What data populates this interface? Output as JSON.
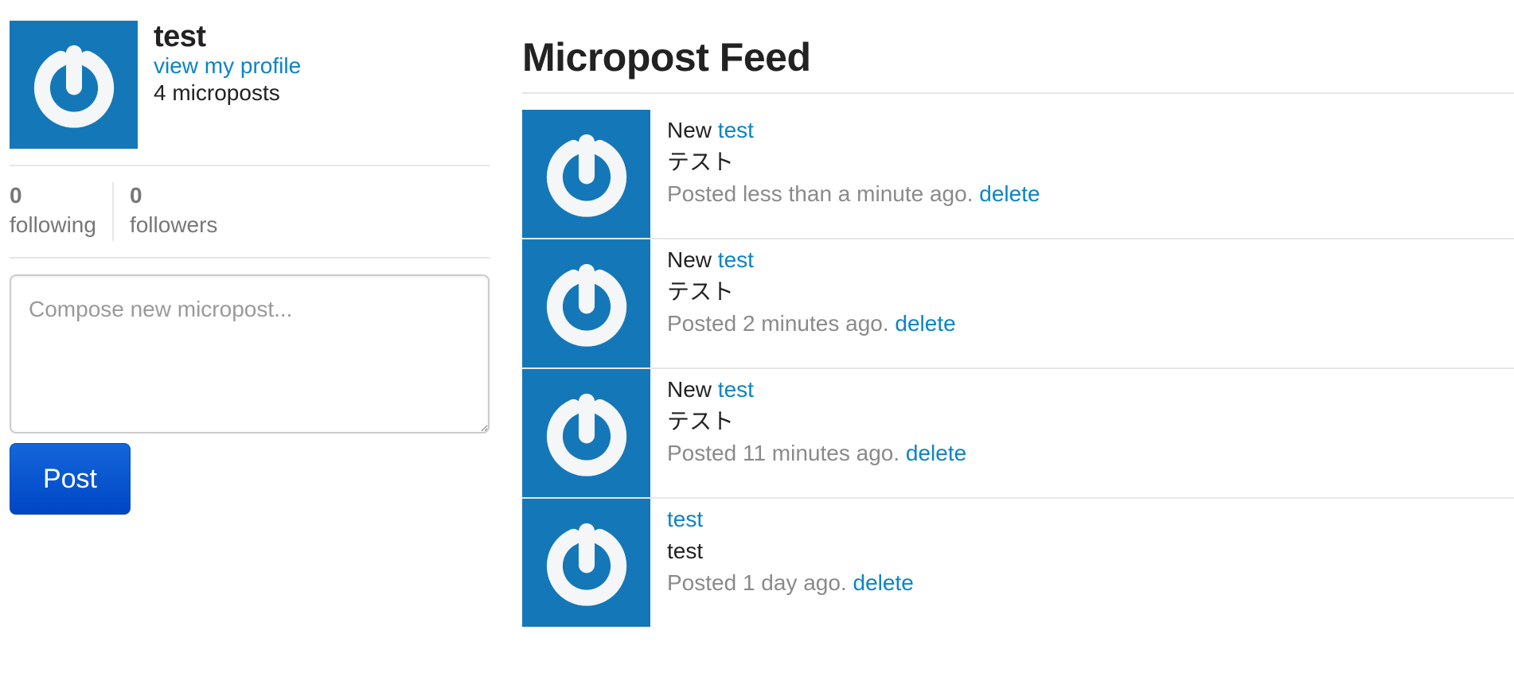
{
  "sidebar": {
    "user_name": "test",
    "profile_link": "view my profile",
    "micropost_count": "4 microposts",
    "stats": {
      "following_count": "0",
      "following_label": "following",
      "followers_count": "0",
      "followers_label": "followers"
    },
    "compose_placeholder": "Compose new micropost...",
    "post_button": "Post"
  },
  "feed": {
    "title": "Micropost Feed",
    "items": [
      {
        "prefix": "New",
        "user": "test",
        "content": "テスト",
        "timestamp": "Posted less than a minute ago.",
        "delete": "delete"
      },
      {
        "prefix": "New",
        "user": "test",
        "content": "テスト",
        "timestamp": "Posted 2 minutes ago.",
        "delete": "delete"
      },
      {
        "prefix": "New",
        "user": "test",
        "content": "テスト",
        "timestamp": "Posted 11 minutes ago.",
        "delete": "delete"
      },
      {
        "prefix": "",
        "user": "test",
        "content": "test",
        "timestamp": "Posted 1 day ago.",
        "delete": "delete"
      }
    ]
  },
  "colors": {
    "avatar_bg": "#1477b8",
    "link": "#0a84c8",
    "button": "#0052cc"
  },
  "icons": {
    "avatar": "gravatar-power-icon"
  }
}
